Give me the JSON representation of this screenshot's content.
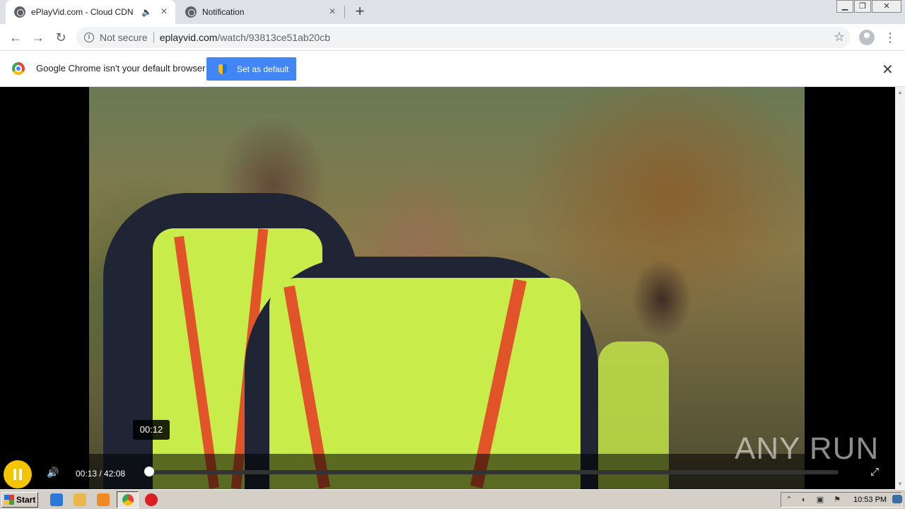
{
  "tabs": [
    {
      "title": "ePlayVid.com - Cloud CDN",
      "audio": true,
      "active": true
    },
    {
      "title": "Notification",
      "audio": false,
      "active": false
    }
  ],
  "omnibox": {
    "security_label": "Not secure",
    "host": "eplayvid.com",
    "path": "/watch/93813ce51ab20cb"
  },
  "infobar": {
    "message": "Google Chrome isn't your default browser",
    "button_label": "Set as default"
  },
  "player": {
    "current_time": "00:13",
    "duration": "42:08",
    "time_display": "00:13 / 42:08",
    "hover_time": "00:12",
    "progress_fraction": 0.005,
    "state": "playing",
    "accent_color": "#f5c400"
  },
  "watermark": "ANY RUN",
  "taskbar": {
    "start_label": "Start",
    "clock": "10:53 PM"
  }
}
